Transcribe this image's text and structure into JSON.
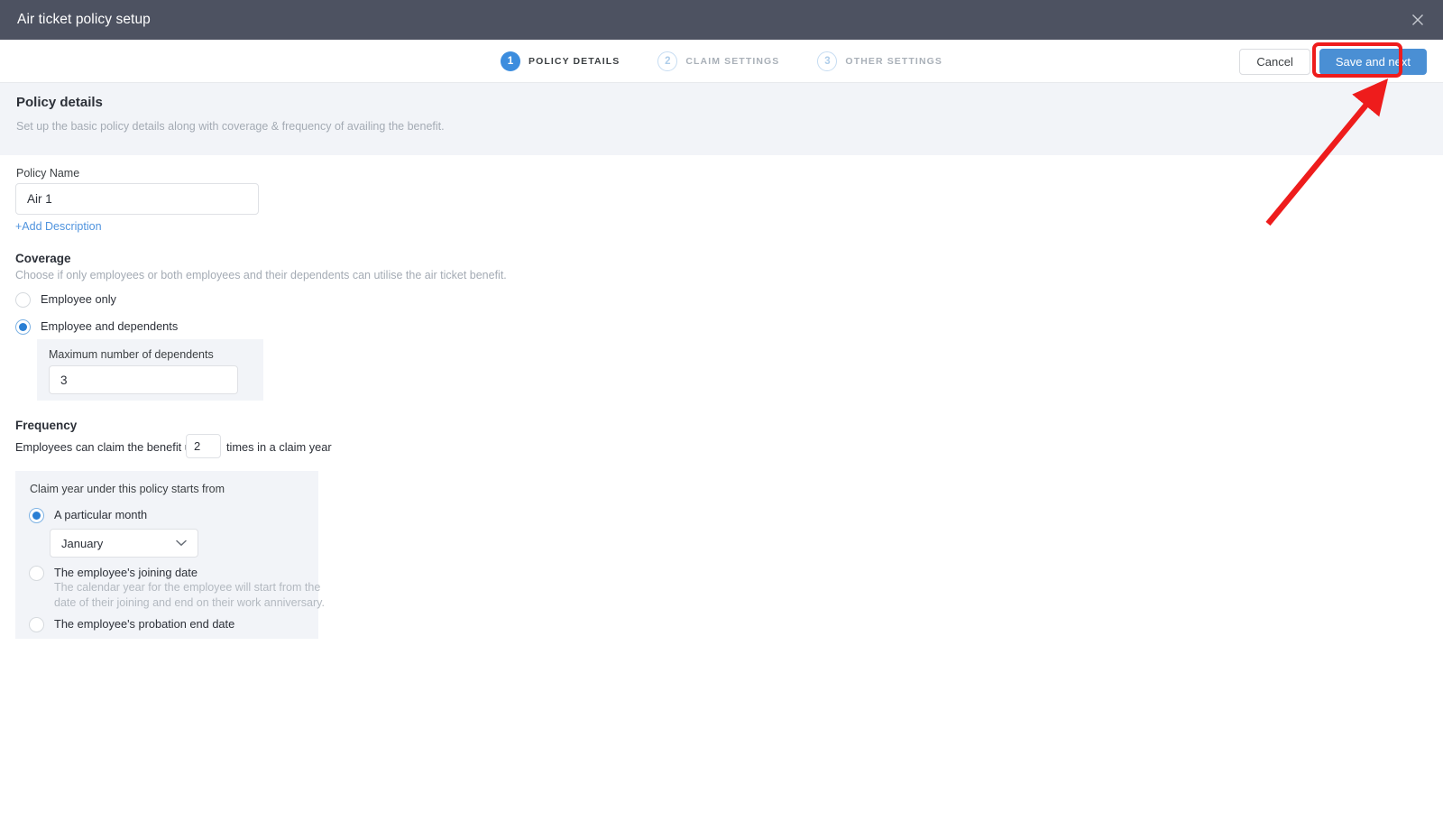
{
  "window": {
    "title": "Air ticket policy setup",
    "close_icon": "close-icon"
  },
  "stepper": {
    "steps": [
      {
        "number": "1",
        "label": "POLICY DETAILS",
        "state": "active"
      },
      {
        "number": "2",
        "label": "CLAIM SETTINGS",
        "state": "inactive"
      },
      {
        "number": "3",
        "label": "OTHER SETTINGS",
        "state": "inactive"
      }
    ]
  },
  "actions": {
    "cancel_label": "Cancel",
    "save_label": "Save and next",
    "primary_color": "#4a8fd4",
    "highlight_color": "#ee1c1c"
  },
  "banner": {
    "title": "Policy details",
    "subtitle": "Set up the basic policy details along with coverage & frequency of availing the benefit."
  },
  "policy_name": {
    "label": "Policy Name",
    "value": "Air 1",
    "placeholder": "Policy Name",
    "add_description_label": "+Add Description"
  },
  "coverage": {
    "title": "Coverage",
    "subtitle": "Choose if only employees or both employees and their dependents can utilise the air ticket benefit.",
    "options": [
      {
        "label": "Employee only",
        "selected": false
      },
      {
        "label": "Employee and dependents",
        "selected": true
      }
    ],
    "max_dependents": {
      "label": "Maximum number of dependents",
      "value": "3",
      "placeholder": "0"
    }
  },
  "frequency": {
    "title": "Frequency",
    "prefix_text": "Employees can claim the benefit up to",
    "times_value": "2",
    "times_placeholder": "0",
    "suffix_text": "times in a claim year",
    "claim_year": {
      "label": "Claim year under this policy starts from",
      "options": [
        {
          "label": "A particular month",
          "selected": true,
          "help": ""
        },
        {
          "label": "The employee's joining date",
          "selected": false,
          "help": "The calendar year for the employee will start from the date of their joining and end on their work anniversary."
        },
        {
          "label": "The employee's probation end date",
          "selected": false,
          "help": ""
        }
      ],
      "month_select": {
        "value": "January",
        "chevron_icon": "chevron-down-icon"
      }
    }
  }
}
